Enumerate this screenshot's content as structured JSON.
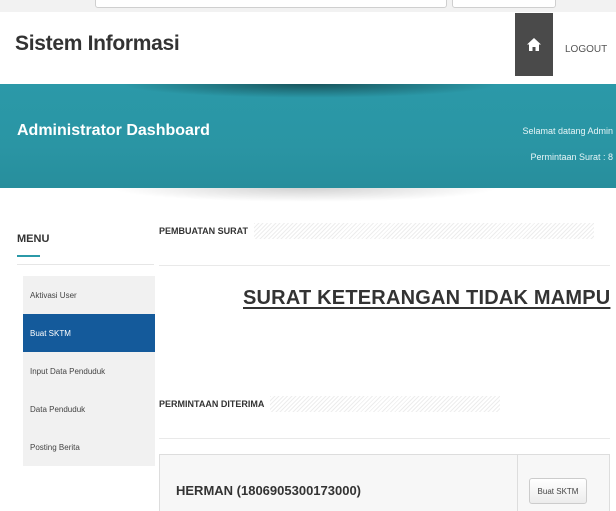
{
  "header": {
    "brand": "Sistem Informasi",
    "home_icon": "home-icon",
    "logout_label": "LOGOUT"
  },
  "banner": {
    "title": "Administrator Dashboard",
    "welcome": "Selamat datang Admin",
    "requests": "Permintaan Surat : 8"
  },
  "sidebar": {
    "title": "MENU",
    "items": [
      {
        "label": "Aktivasi User",
        "active": false
      },
      {
        "label": "Buat SKTM",
        "active": true
      },
      {
        "label": "Input Data Penduduk",
        "active": false
      },
      {
        "label": "Data Penduduk",
        "active": false
      },
      {
        "label": "Posting Berita",
        "active": false
      }
    ]
  },
  "main": {
    "section1_title": "PEMBUATAN SURAT",
    "doc_title": "SURAT KETERANGAN TIDAK MAMPU",
    "section2_title": "PERMINTAAN DITERIMA",
    "requests": [
      {
        "name": "HERMAN (1806905300173000)",
        "action_label": "Buat SKTM"
      }
    ]
  },
  "colors": {
    "accent": "#2b99a8",
    "active_menu": "#145a9b",
    "home_button": "#4a4a4a"
  }
}
